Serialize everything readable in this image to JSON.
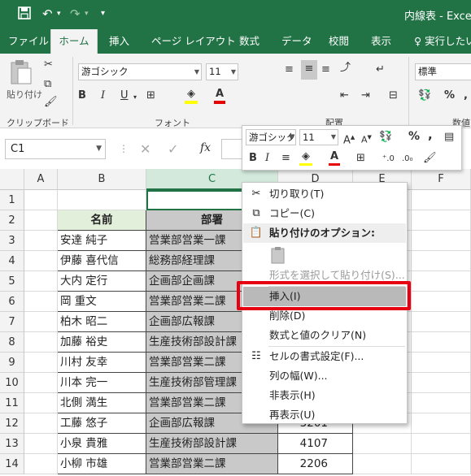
{
  "title_bar": {
    "save_icon": "save-icon",
    "undo_icon": "undo-icon",
    "redo_icon": "redo-icon",
    "customize_icon": "customize-qat-icon",
    "doc_title": "内線表 - Excel"
  },
  "tabs": [
    "ファイル",
    "ホーム",
    "挿入",
    "ページ レイアウト",
    "数式",
    "データ",
    "校閲",
    "表示",
    "実行したい"
  ],
  "active_tab": "ホーム",
  "ribbon": {
    "paste_label": "貼り付け",
    "clipboard_label": "クリップボード",
    "font_name": "游ゴシック",
    "font_size": "11",
    "bold": "B",
    "italic": "I",
    "underline": "U",
    "font_group_label": "フォント",
    "align_group_label": "配置",
    "number_format": "標準",
    "number_group_label": "数値"
  },
  "formula_bar": {
    "name_box": "C1",
    "fx_label": "fx",
    "formula": ""
  },
  "columns": [
    "A",
    "B",
    "C",
    "D",
    "E",
    "F"
  ],
  "selected_column": "C",
  "rows": [
    {
      "num": "1",
      "name": "",
      "dept": "",
      "ext": ""
    },
    {
      "num": "2",
      "name": "名前",
      "dept": "部署",
      "ext": ""
    },
    {
      "num": "3",
      "name": "安達 純子",
      "dept": "営業部営業一課",
      "ext": ""
    },
    {
      "num": "4",
      "name": "伊藤 喜代信",
      "dept": "総務部経理課",
      "ext": ""
    },
    {
      "num": "5",
      "name": "大内 定行",
      "dept": "企画部企画課",
      "ext": ""
    },
    {
      "num": "6",
      "name": "岡 重文",
      "dept": "営業部営業二課",
      "ext": ""
    },
    {
      "num": "7",
      "name": "柏木 昭二",
      "dept": "企画部広報課",
      "ext": ""
    },
    {
      "num": "8",
      "name": "加藤 裕史",
      "dept": "生産技術部設計課",
      "ext": ""
    },
    {
      "num": "9",
      "name": "川村 友幸",
      "dept": "営業部営業二課",
      "ext": ""
    },
    {
      "num": "10",
      "name": "川本 完一",
      "dept": "生産技術部管理課",
      "ext": ""
    },
    {
      "num": "11",
      "name": "北側 満生",
      "dept": "営業部営業二課",
      "ext": ""
    },
    {
      "num": "12",
      "name": "工藤 悠子",
      "dept": "企画部広報課",
      "ext": "3201"
    },
    {
      "num": "13",
      "name": "小泉 貴雅",
      "dept": "生産技術部設計課",
      "ext": "4107"
    },
    {
      "num": "14",
      "name": "小柳 市雄",
      "dept": "営業部営業二課",
      "ext": "2206"
    }
  ],
  "mini_toolbar": {
    "font_name": "游ゴシック",
    "font_size": "11",
    "percent": "%",
    "comma": ","
  },
  "context_menu": {
    "cut": "切り取り(T)",
    "copy": "コピー(C)",
    "paste_options": "貼り付けのオプション:",
    "paste_special": "形式を選択して貼り付け(S)...",
    "insert": "挿入(I)",
    "delete": "削除(D)",
    "clear": "数式と値のクリア(N)",
    "format_cells": "セルの書式設定(F)...",
    "column_width": "列の幅(W)...",
    "hide": "非表示(H)",
    "unhide": "再表示(U)"
  },
  "colors": {
    "excel_green": "#217346",
    "header_fill": "#e2efda",
    "selected_fill": "#c9c9c9",
    "highlight_border": "#e60012"
  }
}
